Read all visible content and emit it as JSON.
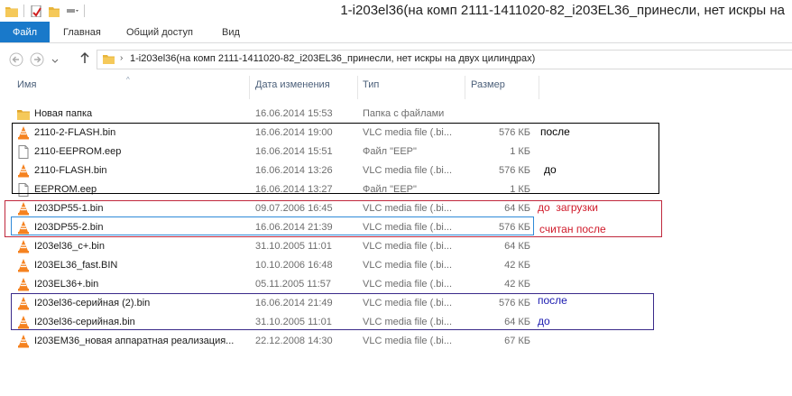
{
  "window": {
    "title": "1-i203el36(на комп 2111-1411020-82_i203EL36_принесли, нет искры на"
  },
  "ribbon": {
    "tabs": [
      "Файл",
      "Главная",
      "Общий доступ",
      "Вид"
    ]
  },
  "address": {
    "path": "1-i203el36(на комп 2111-1411020-82_i203EL36_принесли, нет искры на двух цилиндрах)"
  },
  "columns": {
    "name": "Имя",
    "date": "Дата изменения",
    "type": "Тип",
    "size": "Размер"
  },
  "files": [
    {
      "name": "Новая папка",
      "date": "16.06.2014 15:53",
      "type": "Папка с файлами",
      "size": "",
      "icon": "folder-icon"
    },
    {
      "name": "2110-2-FLASH.bin",
      "date": "16.06.2014 19:00",
      "type": "VLC media file (.bi...",
      "size": "576 КБ",
      "icon": "vlc-icon"
    },
    {
      "name": "2110-EEPROM.eep",
      "date": "16.06.2014 15:51",
      "type": "Файл \"EEP\"",
      "size": "1 КБ",
      "icon": "file-icon"
    },
    {
      "name": "2110-FLASH.bin",
      "date": "16.06.2014 13:26",
      "type": "VLC media file (.bi...",
      "size": "576 КБ",
      "icon": "vlc-icon"
    },
    {
      "name": "EEPROM.eep",
      "date": "16.06.2014 13:27",
      "type": "Файл \"EEP\"",
      "size": "1 КБ",
      "icon": "file-icon"
    },
    {
      "name": "I203DP55-1.bin",
      "date": "09.07.2006 16:45",
      "type": "VLC media file (.bi...",
      "size": "64 КБ",
      "icon": "vlc-icon"
    },
    {
      "name": "I203DP55-2.bin",
      "date": "16.06.2014 21:39",
      "type": "VLC media file (.bi...",
      "size": "576 КБ",
      "icon": "vlc-icon"
    },
    {
      "name": "I203el36_c+.bin",
      "date": "31.10.2005 11:01",
      "type": "VLC media file (.bi...",
      "size": "64 КБ",
      "icon": "vlc-icon"
    },
    {
      "name": "I203EL36_fast.BIN",
      "date": "10.10.2006 16:48",
      "type": "VLC media file (.bi...",
      "size": "42 КБ",
      "icon": "vlc-icon"
    },
    {
      "name": "I203EL36+.bin",
      "date": "05.11.2005 11:57",
      "type": "VLC media file (.bi...",
      "size": "42 КБ",
      "icon": "vlc-icon"
    },
    {
      "name": "I203el36-серийная (2).bin",
      "date": "16.06.2014 21:49",
      "type": "VLC media file (.bi...",
      "size": "576 КБ",
      "icon": "vlc-icon"
    },
    {
      "name": "I203el36-серийная.bin",
      "date": "31.10.2005 11:01",
      "type": "VLC media file (.bi...",
      "size": "64 КБ",
      "icon": "vlc-icon"
    },
    {
      "name": "I203EM36_новая аппаратная реализация...",
      "date": "22.12.2008 14:30",
      "type": "VLC media file (.bi...",
      "size": "67 КБ",
      "icon": "vlc-icon"
    }
  ],
  "annotations": {
    "posle_1": "после",
    "do_1": "до",
    "do_zagruzki": "до  загрузки",
    "schitan_posle": "считан после",
    "posle_2": "после",
    "do_2": "до"
  },
  "colors": {
    "accent": "#1979ca",
    "box_black": "#000000",
    "box_red": "#c0283c",
    "box_blue": "#2f8ad8",
    "box_purple": "#3a2a8a",
    "note_red": "#d01a2a",
    "note_blue": "#1a1ab0"
  }
}
